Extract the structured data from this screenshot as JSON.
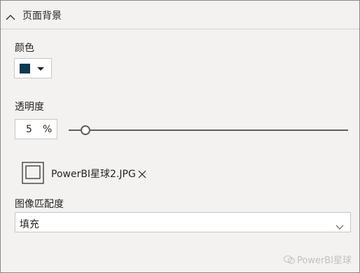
{
  "section": {
    "title": "页面背景",
    "collapse_icon": "chevron-up-icon"
  },
  "color": {
    "label": "颜色",
    "value": "#0c3a50"
  },
  "transparency": {
    "label": "透明度",
    "value": "5",
    "unit": "%",
    "fraction": 0.05
  },
  "image": {
    "file_name": "PowerBI星球2.JPG",
    "remove_symbol": "✕"
  },
  "fit": {
    "label": "图像匹配度",
    "selected": "填充"
  },
  "watermark": {
    "text": "PowerBI星球"
  }
}
